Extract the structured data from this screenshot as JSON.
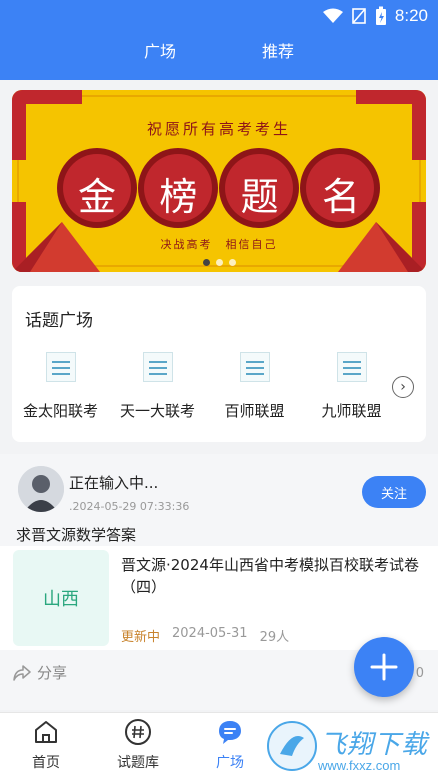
{
  "status_bar": {
    "time": "8:20",
    "icons": [
      "wifi-icon",
      "signal-icon",
      "battery-icon"
    ]
  },
  "header": {
    "tabs": [
      "广场",
      "推荐"
    ]
  },
  "banner": {
    "top_text": "祝愿所有高考考生",
    "main_chars": [
      "金",
      "榜",
      "题",
      "名"
    ],
    "bottom_text": "决战高考　相信自己",
    "slides": 3,
    "active_slide": 0
  },
  "topics": {
    "title": "话题广场",
    "items": [
      "金太阳联考",
      "天一大联考",
      "百师联盟",
      "九师联盟"
    ]
  },
  "post": {
    "author": "正在输入中...",
    "time": ".2024-05-29 07:33:36",
    "follow_label": "关注",
    "question": "求晋文源数学答案",
    "doc": {
      "thumb_label": "山西",
      "title": "晋文源·2024年山西省中考模拟百校联考试卷（四）",
      "status": "更新中",
      "date": "2024-05-31",
      "views": "29人"
    },
    "share_label": "分享",
    "share_count": "0"
  },
  "bottom_nav": {
    "items": [
      "首页",
      "试题库",
      "广场"
    ],
    "active": "广场"
  },
  "watermark": {
    "text": "飞翔下载",
    "url": "www.fxxz.com"
  },
  "colors": {
    "primary": "#3c82f5",
    "banner_yellow": "#f5c400",
    "banner_red": "#c0272d",
    "tag_orange": "#c8832c"
  }
}
